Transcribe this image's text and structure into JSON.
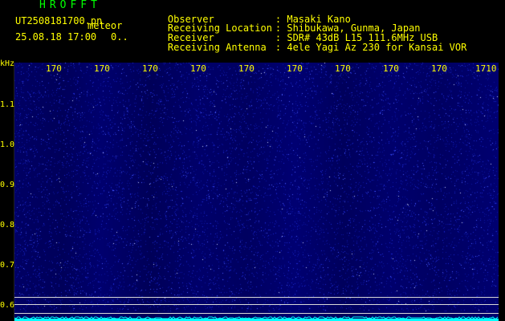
{
  "header": {
    "app_title": "HROFFT",
    "file_name": "UT2508181700.pn",
    "source_label": "meteor",
    "date_time": "25.08.18 17:00",
    "counter": "0.."
  },
  "meta": [
    {
      "key": "Observer",
      "value": ": Masaki Kano"
    },
    {
      "key": "Receiving Location",
      "value": ": Shibukawa, Gunma, Japan"
    },
    {
      "key": "Receiver",
      "value": ": SDR# 43dB L15 111.6MHz USB"
    },
    {
      "key": "Receiving Antenna",
      "value": ": 4ele Yagi Az 230 for Kansai VOR"
    }
  ],
  "axes": {
    "y_unit": "kHz",
    "y_ticks": [
      "1.1",
      "1.0",
      "0.9",
      "0.8",
      "0.7",
      "0.6"
    ],
    "x_ticks": [
      "170",
      "170",
      "170",
      "170",
      "170",
      "170",
      "170",
      "170",
      "170",
      "1710"
    ]
  },
  "colors": {
    "background": "#000000",
    "text": "#ffff00",
    "title": "#00ff00",
    "spectrum": "#000080",
    "trace": "#00ffff",
    "marker_lines": "#d8d8d8"
  }
}
